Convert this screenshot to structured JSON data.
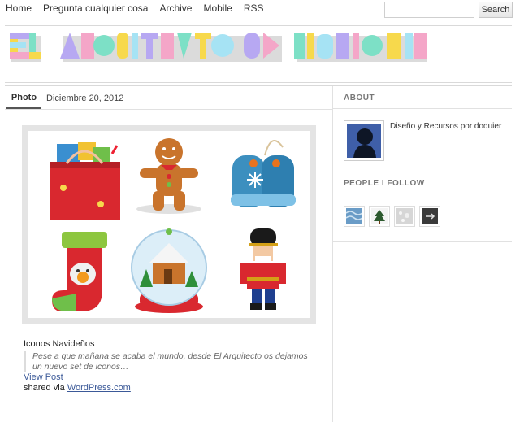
{
  "nav": {
    "items": [
      "Home",
      "Pregunta cualquier cosa",
      "Archive",
      "Mobile",
      "RSS"
    ]
  },
  "search": {
    "placeholder": "",
    "button_label": "Search"
  },
  "blog": {
    "title": "EL ARQUITECTO DE ILUSIONES",
    "logo_colors": [
      "#f7d94c",
      "#b7a8f2",
      "#7de0c6",
      "#f4a6c8",
      "#a6e3f4"
    ]
  },
  "post": {
    "type_tab": "Photo",
    "date": "Diciembre 20, 2012",
    "caption_title": "Iconos Navideños",
    "caption_quote": "Pese a que mañana se acaba el mundo, desde El Arquitecto os dejamos un nuevo set de iconos…",
    "view_post": "View Post",
    "shared_prefix": "shared via ",
    "shared_link": "WordPress.com"
  },
  "sidebar": {
    "about_heading": "ABOUT",
    "about_text": "Diseño y Recursos por doquier",
    "follow_heading": "PEOPLE I FOLLOW",
    "follow_icons": [
      "blue-pattern-icon",
      "christmas-tree-icon",
      "snowy-texture-icon",
      "dark-arrow-icon"
    ]
  }
}
